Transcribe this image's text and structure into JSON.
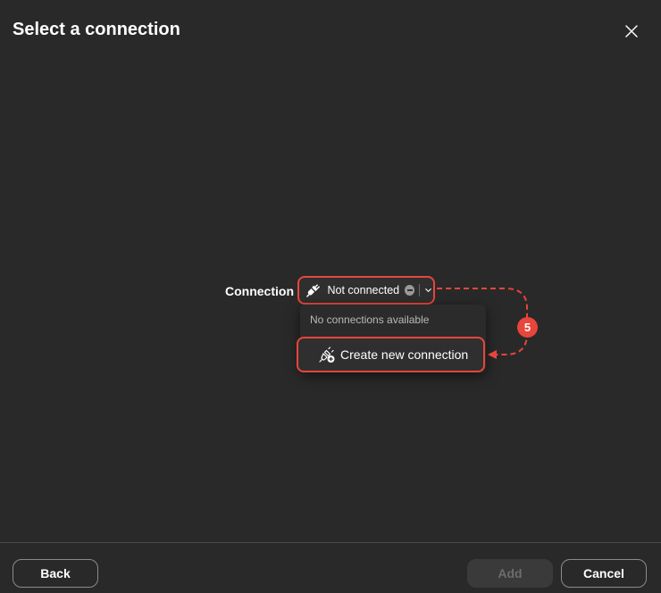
{
  "dialog": {
    "title": "Select a connection",
    "close_icon": "close-icon"
  },
  "connection": {
    "label": "Connection",
    "status": "Not connected",
    "status_icon": "plug-icon",
    "status_badge_icon": "minus-circle-icon",
    "dropdown_icon": "chevron-down-icon"
  },
  "dropdown": {
    "empty_message": "No connections available",
    "create_label": "Create new connection",
    "create_icon": "add-connection-icon"
  },
  "annotation": {
    "step_number": "5",
    "color": "#e8453c"
  },
  "footer": {
    "back_label": "Back",
    "add_label": "Add",
    "cancel_label": "Cancel"
  },
  "colors": {
    "background": "#292929",
    "highlight": "#e8453c"
  }
}
